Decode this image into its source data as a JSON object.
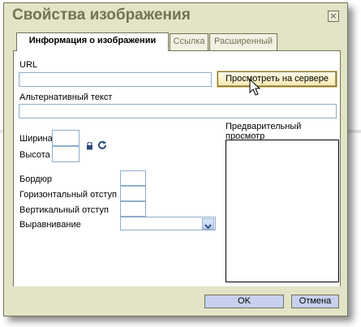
{
  "dialog": {
    "title": "Свойства изображения",
    "close_glyph": "×"
  },
  "tabs": [
    {
      "label": "Информация о изображении",
      "active": true
    },
    {
      "label": "Ссылка",
      "active": false
    },
    {
      "label": "Расширенный",
      "active": false
    }
  ],
  "form": {
    "url_label": "URL",
    "url_value": "",
    "browse_button": "Просмотреть на сервере",
    "alt_label": "Альтернативный текст",
    "alt_value": "",
    "width_label": "Ширина",
    "width_value": "",
    "height_label": "Высота",
    "height_value": "",
    "border_label": "Бордюр",
    "border_value": "",
    "hspace_label": "Горизонтальный отступ",
    "hspace_value": "",
    "vspace_label": "Вертикальный отступ",
    "vspace_value": "",
    "align_label": "Выравнивание",
    "align_value": "",
    "preview_label": "Предварительный просмотр"
  },
  "icons": {
    "lock": "lock-icon",
    "reset": "reset-size-icon",
    "cursor": "mouse-pointer-icon"
  },
  "footer": {
    "ok_button": "OK",
    "cancel_button": "Отмена"
  },
  "colors": {
    "dialog_bg": "#e3e3c7",
    "border": "#737357",
    "footer_button_bg": "#c7d1ee",
    "input_border": "#8faecb"
  }
}
